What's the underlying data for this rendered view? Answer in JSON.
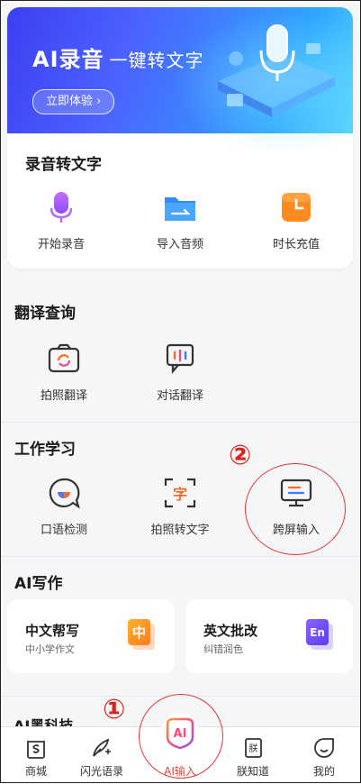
{
  "banner": {
    "title": "AI录音",
    "subtitle": "一键转文字",
    "button": "立即体验 ›"
  },
  "sections": {
    "recording": {
      "title": "录音转文字",
      "items": [
        "开始录音",
        "导入音频",
        "时长充值"
      ]
    },
    "translate": {
      "title": "翻译查询",
      "items": [
        "拍照翻译",
        "对话翻译"
      ]
    },
    "work": {
      "title": "工作学习",
      "items": [
        "口语检测",
        "拍照转文字",
        "跨屏输入"
      ]
    },
    "writing": {
      "title": "AI写作",
      "cards": [
        {
          "title": "中文帮写",
          "subtitle": "中小学作文",
          "badge": "中"
        },
        {
          "title": "英文批改",
          "subtitle": "纠错润色",
          "badge": "En"
        }
      ]
    },
    "partial": {
      "title": "AI黑科技"
    }
  },
  "tabbar": {
    "items": [
      "商城",
      "闪光语录",
      "AI输入",
      "朕知道",
      "我的"
    ],
    "active_index": 2,
    "center_badge": "AI"
  },
  "annotations": {
    "mark1": "①",
    "mark2": "②"
  },
  "colors": {
    "accent": "#e8443b",
    "banner_start": "#3d3ff2",
    "banner_end": "#5ad5ff",
    "annotation": "#d9251d"
  }
}
